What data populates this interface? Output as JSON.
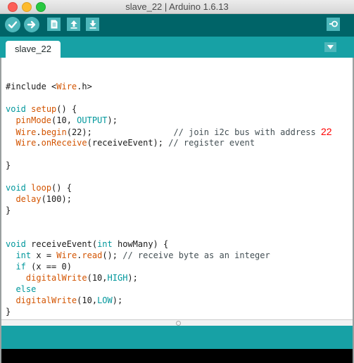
{
  "window": {
    "title": "slave_22 | Arduino 1.6.13"
  },
  "toolbar": {
    "buttons": [
      {
        "name": "verify",
        "icon": "checkmark-icon"
      },
      {
        "name": "upload",
        "icon": "arrow-right-icon"
      },
      {
        "name": "new",
        "icon": "document-icon"
      },
      {
        "name": "open",
        "icon": "arrow-up-icon"
      },
      {
        "name": "save",
        "icon": "arrow-down-icon"
      },
      {
        "name": "serial-monitor",
        "icon": "magnifier-icon"
      }
    ]
  },
  "tabs": [
    {
      "label": "slave_22"
    }
  ],
  "editor": {
    "lines": [
      [
        {
          "t": "#include <",
          "s": ""
        },
        {
          "t": "Wire",
          "s": "f"
        },
        {
          "t": ".h>",
          "s": ""
        }
      ],
      [],
      [
        {
          "t": "void",
          "s": "k"
        },
        {
          "t": " ",
          "s": ""
        },
        {
          "t": "setup",
          "s": "f"
        },
        {
          "t": "() {",
          "s": ""
        }
      ],
      [
        {
          "t": "  ",
          "s": ""
        },
        {
          "t": "pinMode",
          "s": "f"
        },
        {
          "t": "(10, ",
          "s": ""
        },
        {
          "t": "OUTPUT",
          "s": "k"
        },
        {
          "t": ");",
          "s": ""
        }
      ],
      [
        {
          "t": "  ",
          "s": ""
        },
        {
          "t": "Wire",
          "s": "f"
        },
        {
          "t": ".",
          "s": ""
        },
        {
          "t": "begin",
          "s": "f"
        },
        {
          "t": "(22);                ",
          "s": ""
        },
        {
          "t": "// join i2c bus with address ",
          "s": "c"
        },
        {
          "t": "22",
          "s": "r"
        }
      ],
      [
        {
          "t": "  ",
          "s": ""
        },
        {
          "t": "Wire",
          "s": "f"
        },
        {
          "t": ".",
          "s": ""
        },
        {
          "t": "onReceive",
          "s": "f"
        },
        {
          "t": "(receiveEvent); ",
          "s": ""
        },
        {
          "t": "// register event",
          "s": "c"
        }
      ],
      [],
      [
        {
          "t": "}",
          "s": ""
        }
      ],
      [],
      [
        {
          "t": "void",
          "s": "k"
        },
        {
          "t": " ",
          "s": ""
        },
        {
          "t": "loop",
          "s": "f"
        },
        {
          "t": "() {",
          "s": ""
        }
      ],
      [
        {
          "t": "  ",
          "s": ""
        },
        {
          "t": "delay",
          "s": "f"
        },
        {
          "t": "(100);",
          "s": ""
        }
      ],
      [
        {
          "t": "}",
          "s": ""
        }
      ],
      [],
      [],
      [
        {
          "t": "void",
          "s": "k"
        },
        {
          "t": " receiveEvent(",
          "s": ""
        },
        {
          "t": "int",
          "s": "k"
        },
        {
          "t": " howMany) {",
          "s": ""
        }
      ],
      [
        {
          "t": "  ",
          "s": ""
        },
        {
          "t": "int",
          "s": "k"
        },
        {
          "t": " x = ",
          "s": ""
        },
        {
          "t": "Wire",
          "s": "f"
        },
        {
          "t": ".",
          "s": ""
        },
        {
          "t": "read",
          "s": "f"
        },
        {
          "t": "(); ",
          "s": ""
        },
        {
          "t": "// receive byte as an integer",
          "s": "c"
        }
      ],
      [
        {
          "t": "  ",
          "s": ""
        },
        {
          "t": "if",
          "s": "k"
        },
        {
          "t": " (x == 0)",
          "s": ""
        }
      ],
      [
        {
          "t": "    ",
          "s": ""
        },
        {
          "t": "digitalWrite",
          "s": "f"
        },
        {
          "t": "(10,",
          "s": ""
        },
        {
          "t": "HIGH",
          "s": "k"
        },
        {
          "t": ");",
          "s": ""
        }
      ],
      [
        {
          "t": "  ",
          "s": ""
        },
        {
          "t": "else",
          "s": "k"
        }
      ],
      [
        {
          "t": "  ",
          "s": ""
        },
        {
          "t": "digitalWrite",
          "s": "f"
        },
        {
          "t": "(10,",
          "s": ""
        },
        {
          "t": "LOW",
          "s": "k"
        },
        {
          "t": ");",
          "s": ""
        }
      ],
      [
        {
          "t": "}",
          "s": ""
        }
      ]
    ]
  },
  "colors": {
    "toolbar": "#006468",
    "tabbar": "#17a1a5",
    "button": "#4db7bb",
    "keyword": "#00979c",
    "function": "#d35400",
    "comment": "#434f54",
    "highlight": "#ff0000"
  }
}
